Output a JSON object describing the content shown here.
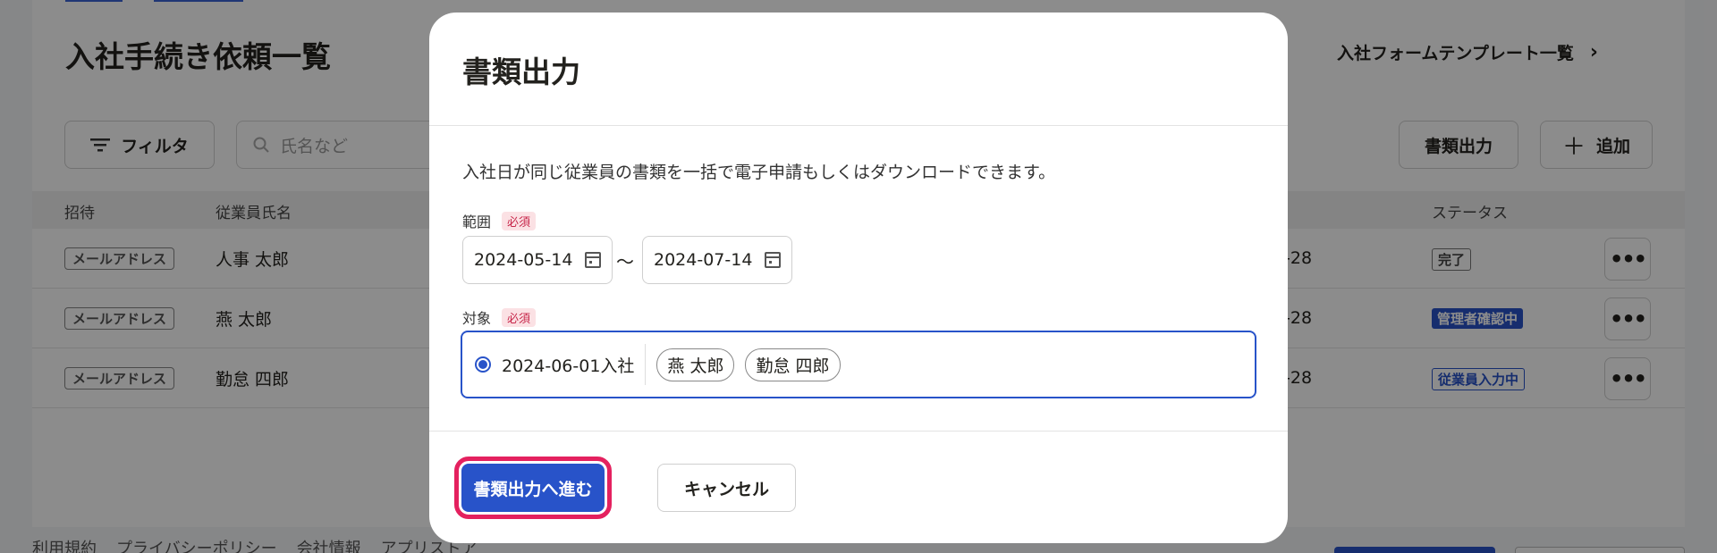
{
  "background": {
    "page_title": "入社手続き依頼一覧",
    "template_link": "入社フォームテンプレート一覧",
    "filter_label": "フィルタ",
    "search_placeholder": "氏名など",
    "export_label": "書類出力",
    "add_label": "追加",
    "columns": [
      "招待",
      "従業員氏名",
      "ステータス"
    ],
    "rows": [
      {
        "invite": "メールアドレス",
        "name": "人事 太郎",
        "date": "-28",
        "status": "完了"
      },
      {
        "invite": "メールアドレス",
        "name": "燕 太郎",
        "date": "-28",
        "status": "管理者確認中"
      },
      {
        "invite": "メールアドレス",
        "name": "勤怠 四郎",
        "date": "-28",
        "status": "従業員入力中"
      }
    ],
    "footer_links": [
      "利用規約",
      "プライバシーポリシー",
      "会社情報",
      "アプリストア"
    ]
  },
  "modal": {
    "title": "書類出力",
    "description": "入社日が同じ従業員の書類を一括で電子申請もしくはダウンロードできます。",
    "range_label": "範囲",
    "required_badge": "必須",
    "date_from": "2024-05-14",
    "date_to": "2024-07-14",
    "range_separator": "〜",
    "target_label": "対象",
    "target_date": "2024-06-01入社",
    "target_names": [
      "燕 太郎",
      "勤怠 四郎"
    ],
    "primary_button": "書類出力へ進む",
    "cancel_button": "キャンセル"
  },
  "colors": {
    "primary": "#2853c9",
    "highlight": "#e4215f",
    "required_bg": "#fbe1e4",
    "required_text": "#c7264a"
  }
}
